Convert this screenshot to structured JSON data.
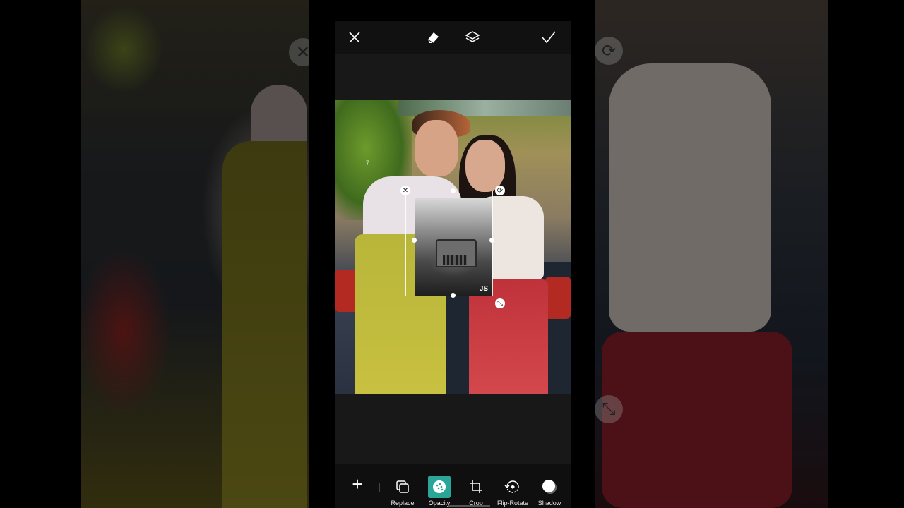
{
  "topbar": {
    "close": "close-icon",
    "eraser": "eraser-icon",
    "layers": "layers-icon",
    "apply": "check-icon"
  },
  "canvas": {
    "watermark": "7"
  },
  "sticker": {
    "logo": "JS"
  },
  "toolbar": {
    "add": "+",
    "tools": [
      {
        "label": "Replace",
        "icon": "replace-icon"
      },
      {
        "label": "Opacity",
        "icon": "opacity-icon",
        "active": true
      },
      {
        "label": "Crop",
        "icon": "crop-icon"
      },
      {
        "label": "Flip-Rotate",
        "icon": "flip-rotate-icon"
      },
      {
        "label": "Shadow",
        "icon": "shadow-icon"
      }
    ]
  },
  "colors": {
    "accent": "#2aa698",
    "toolbar_bg": "#0f0f0f"
  }
}
